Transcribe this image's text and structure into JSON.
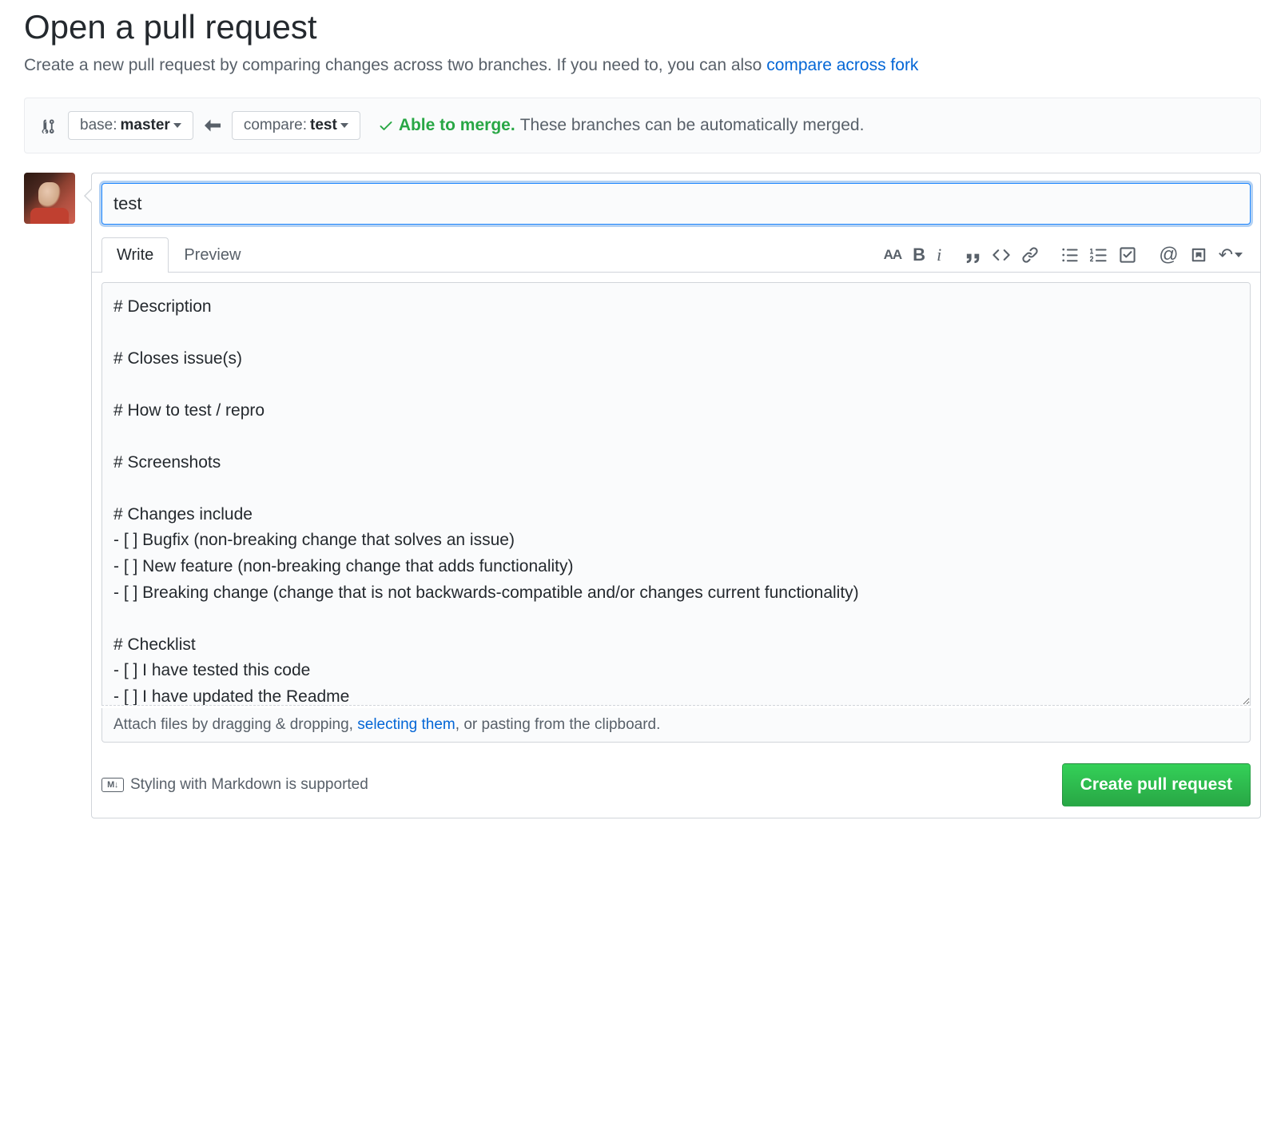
{
  "page": {
    "title": "Open a pull request",
    "subtitle_prefix": "Create a new pull request by comparing changes across two branches. If you need to, you can also ",
    "subtitle_link": "compare across fork"
  },
  "branches": {
    "base_label": "base: ",
    "base_value": "master",
    "compare_label": "compare: ",
    "compare_value": "test"
  },
  "merge": {
    "status": "Able to merge.",
    "detail": "These branches can be automatically merged."
  },
  "pr": {
    "title_value": "test",
    "body_value": "# Description\n\n# Closes issue(s)\n\n# How to test / repro\n\n# Screenshots\n\n# Changes include\n- [ ] Bugfix (non-breaking change that solves an issue)\n- [ ] New feature (non-breaking change that adds functionality)\n- [ ] Breaking change (change that is not backwards-compatible and/or changes current functionality)\n\n# Checklist\n- [ ] I have tested this code\n- [ ] I have updated the Readme"
  },
  "tabs": {
    "write": "Write",
    "preview": "Preview"
  },
  "attach": {
    "prefix": "Attach files by dragging & dropping, ",
    "link": "selecting them",
    "suffix": ", or pasting from the clipboard."
  },
  "footer": {
    "md_badge": "M↓",
    "md_note": "Styling with Markdown is supported",
    "submit": "Create pull request"
  }
}
